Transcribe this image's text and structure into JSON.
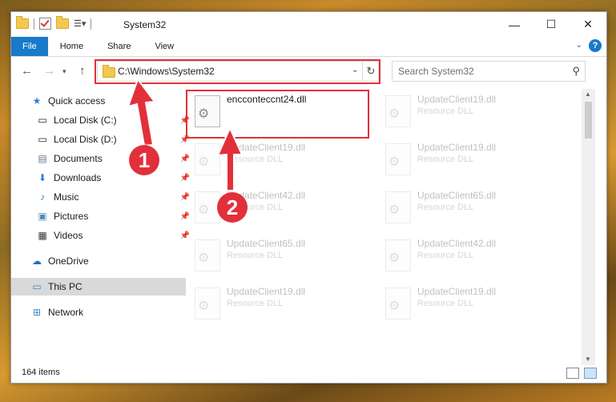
{
  "window": {
    "title": "System32",
    "controls": {
      "minimize": "—",
      "maximize": "☐",
      "close": "✕"
    }
  },
  "ribbon": {
    "tabs": [
      "File",
      "Home",
      "Share",
      "View"
    ],
    "help": "?"
  },
  "navigation": {
    "back_icon": "arrow-left-icon",
    "forward_icon": "arrow-right-icon",
    "recent_icon": "chevron-down-icon",
    "up_icon": "arrow-up-icon",
    "address": "C:\\Windows\\System32",
    "search_placeholder": "Search System32"
  },
  "sidebar": {
    "items": [
      {
        "label": "Quick access",
        "icon": "star-icon",
        "pinned": false
      },
      {
        "label": "Local Disk (C:)",
        "icon": "drive-icon",
        "pinned": true
      },
      {
        "label": "Local Disk (D:)",
        "icon": "drive-icon",
        "pinned": true
      },
      {
        "label": "Documents",
        "icon": "documents-icon",
        "pinned": true
      },
      {
        "label": "Downloads",
        "icon": "download-icon",
        "pinned": true
      },
      {
        "label": "Music",
        "icon": "music-icon",
        "pinned": true
      },
      {
        "label": "Pictures",
        "icon": "pictures-icon",
        "pinned": true
      },
      {
        "label": "Videos",
        "icon": "videos-icon",
        "pinned": true
      },
      {
        "label": "OneDrive",
        "icon": "cloud-icon",
        "pinned": false
      },
      {
        "label": "This PC",
        "icon": "computer-icon",
        "pinned": false,
        "selected": true
      },
      {
        "label": "Network",
        "icon": "network-icon",
        "pinned": false
      }
    ]
  },
  "files": [
    {
      "name": "encconteccnt24.dll",
      "type": "",
      "highlighted": true
    },
    {
      "name": "UpdateClient19.dll",
      "type": "Resource DLL"
    },
    {
      "name": "UpdateClient19.dll",
      "type": "Resource DLL"
    },
    {
      "name": "UpdateClient19.dll",
      "type": "Resource DLL"
    },
    {
      "name": "UpdateClient42.dll",
      "type": "Resource DLL"
    },
    {
      "name": "UpdateClient65.dll",
      "type": "Resource DLL"
    },
    {
      "name": "UpdateClient65.dll",
      "type": "Resource DLL"
    },
    {
      "name": "UpdateClient42.dll",
      "type": "Resource DLL"
    },
    {
      "name": "UpdateClient19.dll",
      "type": "Resource DLL"
    },
    {
      "name": "UpdateClient19.dll",
      "type": "Resource DLL"
    }
  ],
  "status": {
    "item_count": "164 items"
  },
  "annotations": {
    "step1": "1",
    "step2": "2",
    "color": "#e2303a"
  }
}
